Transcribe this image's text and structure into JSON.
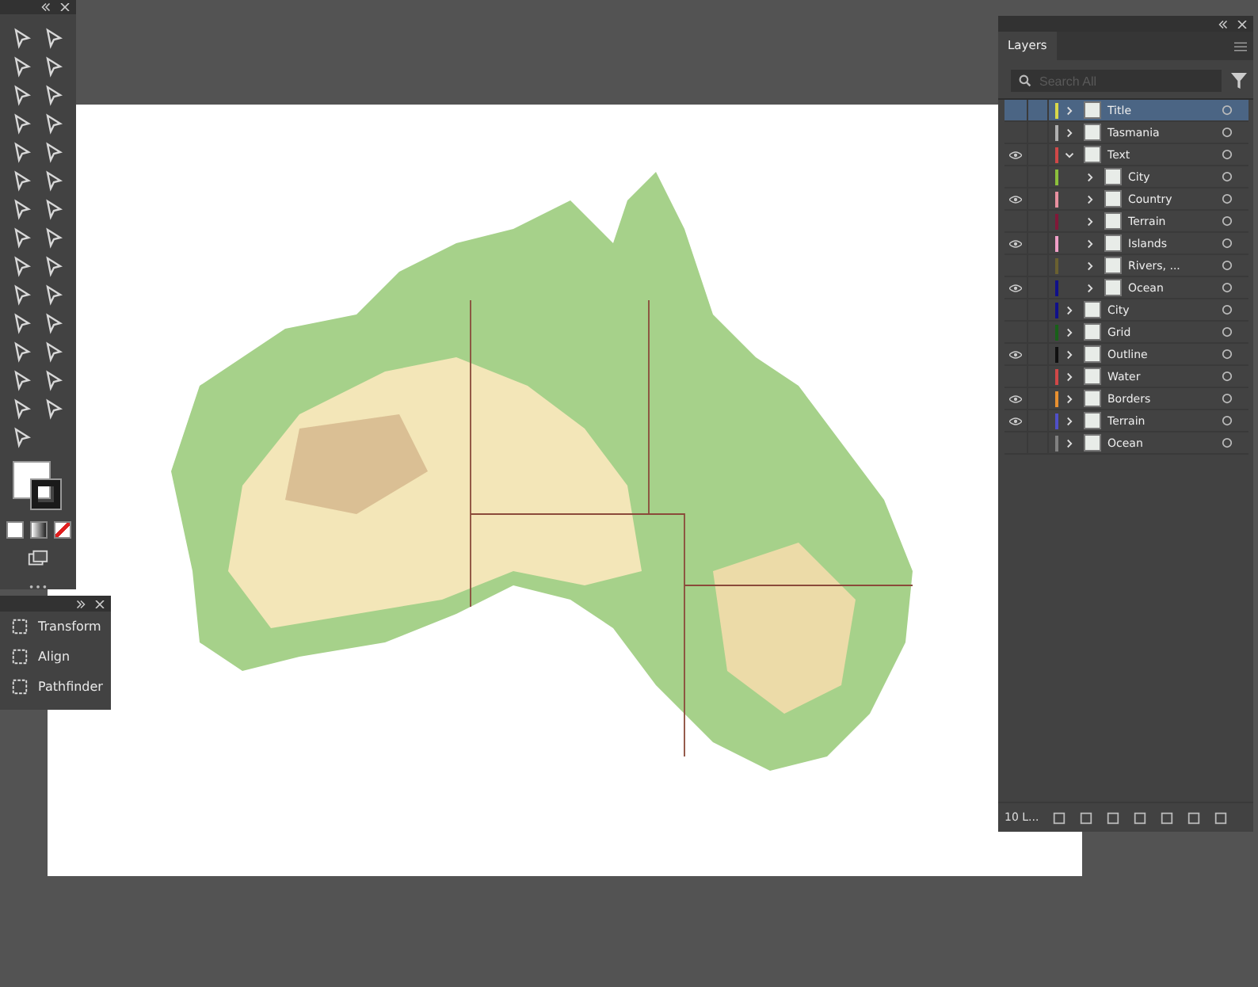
{
  "layers_panel": {
    "tab": "Layers",
    "search": {
      "placeholder": "Search All"
    },
    "layers": [
      {
        "name": "Title",
        "color": "#d8d84a",
        "visible": false,
        "selected": true,
        "expanded": false
      },
      {
        "name": "Tasmania",
        "color": "#b0b0b0",
        "visible": false,
        "selected": false,
        "expanded": false
      },
      {
        "name": "Text",
        "color": "#d04848",
        "visible": true,
        "selected": false,
        "expanded": true,
        "children": [
          {
            "name": "City",
            "color": "#8cc03c",
            "visible": false,
            "selected": false,
            "expanded": false
          },
          {
            "name": "Country",
            "color": "#e890a0",
            "visible": true,
            "selected": false,
            "expanded": false
          },
          {
            "name": "Terrain",
            "color": "#801838",
            "visible": false,
            "selected": false,
            "expanded": false
          },
          {
            "name": "Islands",
            "color": "#f0a0c8",
            "visible": true,
            "selected": false,
            "expanded": false
          },
          {
            "name": "Rivers, ...",
            "color": "#6a6030",
            "visible": false,
            "selected": false,
            "expanded": false
          },
          {
            "name": "Ocean",
            "color": "#10108a",
            "visible": true,
            "selected": false,
            "expanded": false
          }
        ]
      },
      {
        "name": "City",
        "color": "#10108a",
        "visible": false,
        "selected": false,
        "expanded": false
      },
      {
        "name": "Grid",
        "color": "#186018",
        "visible": false,
        "selected": false,
        "expanded": false
      },
      {
        "name": "Outline",
        "color": "#101010",
        "visible": true,
        "selected": false,
        "expanded": false
      },
      {
        "name": "Water",
        "color": "#d04848",
        "visible": false,
        "selected": false,
        "expanded": false
      },
      {
        "name": "Borders",
        "color": "#e89030",
        "visible": true,
        "selected": false,
        "expanded": false
      },
      {
        "name": "Terrain",
        "color": "#5050c8",
        "visible": true,
        "selected": false,
        "expanded": false
      },
      {
        "name": "Ocean",
        "color": "#808080",
        "visible": false,
        "selected": false,
        "expanded": false
      }
    ],
    "layer_count": "10 L..."
  },
  "properties_panel": {
    "items": [
      "Transform",
      "Align",
      "Pathfinder"
    ]
  }
}
